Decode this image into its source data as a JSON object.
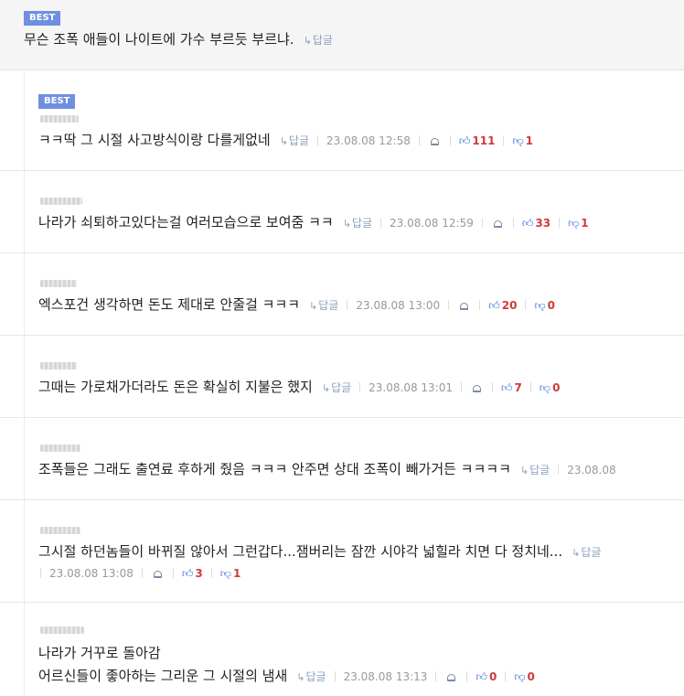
{
  "parent": {
    "badge": "BEST",
    "text": "무슨 조폭 애들이 나이트에 가수 부르듯 부르냐.",
    "reply_label": "답글"
  },
  "comments": [
    {
      "badge": "BEST",
      "lines": [
        "ㅋㅋ딱 그 시절 사고방식이랑 다를게없네"
      ],
      "reply_label": "답글",
      "date": "23.08.08 12:58",
      "up": "111",
      "down": "1"
    },
    {
      "lines": [
        "나라가 쇠퇴하고있다는걸 여러모습으로 보여줌 ㅋㅋ"
      ],
      "reply_label": "답글",
      "date": "23.08.08 12:59",
      "up": "33",
      "down": "1"
    },
    {
      "lines": [
        "엑스포건 생각하면 돈도 제대로 안줄걸 ㅋㅋㅋ"
      ],
      "reply_label": "답글",
      "date": "23.08.08 13:00",
      "up": "20",
      "down": "0"
    },
    {
      "lines": [
        "그때는 가로채가더라도 돈은 확실히 지불은 했지"
      ],
      "reply_label": "답글",
      "date": "23.08.08 13:01",
      "up": "7",
      "down": "0"
    },
    {
      "lines": [
        "조폭들은 그래도 출연료 후하게 줬음 ㅋㅋㅋ 안주면 상대 조폭이 빼가거든 ㅋㅋㅋㅋ"
      ],
      "reply_label": "답글",
      "date": "23.08.08"
    },
    {
      "lines": [
        "그시절 하던놈들이 바뀌질 않아서 그런갑다...잼버리는 잠깐 시야각 넓힐라 치면 다 정치네..."
      ],
      "reply_label": "답글",
      "date": "23.08.08 13:08",
      "up": "3",
      "down": "1"
    },
    {
      "lines": [
        "나라가 거꾸로 돌아감",
        "어르신들이 좋아하는 그리운 그 시절의 냄새"
      ],
      "reply_label": "답글",
      "date": "23.08.08 13:13",
      "up": "0",
      "down": "0"
    }
  ],
  "icons": {
    "reply": "reply-arrow-icon",
    "bell": "report-bell-icon",
    "up": "thumbs-up-icon",
    "down": "thumbs-down-icon"
  },
  "colors": {
    "badge": "#6f8fe0",
    "vote": "#d03a3a",
    "icon": "#3b6fd6",
    "reply": "#8a9fbf"
  }
}
